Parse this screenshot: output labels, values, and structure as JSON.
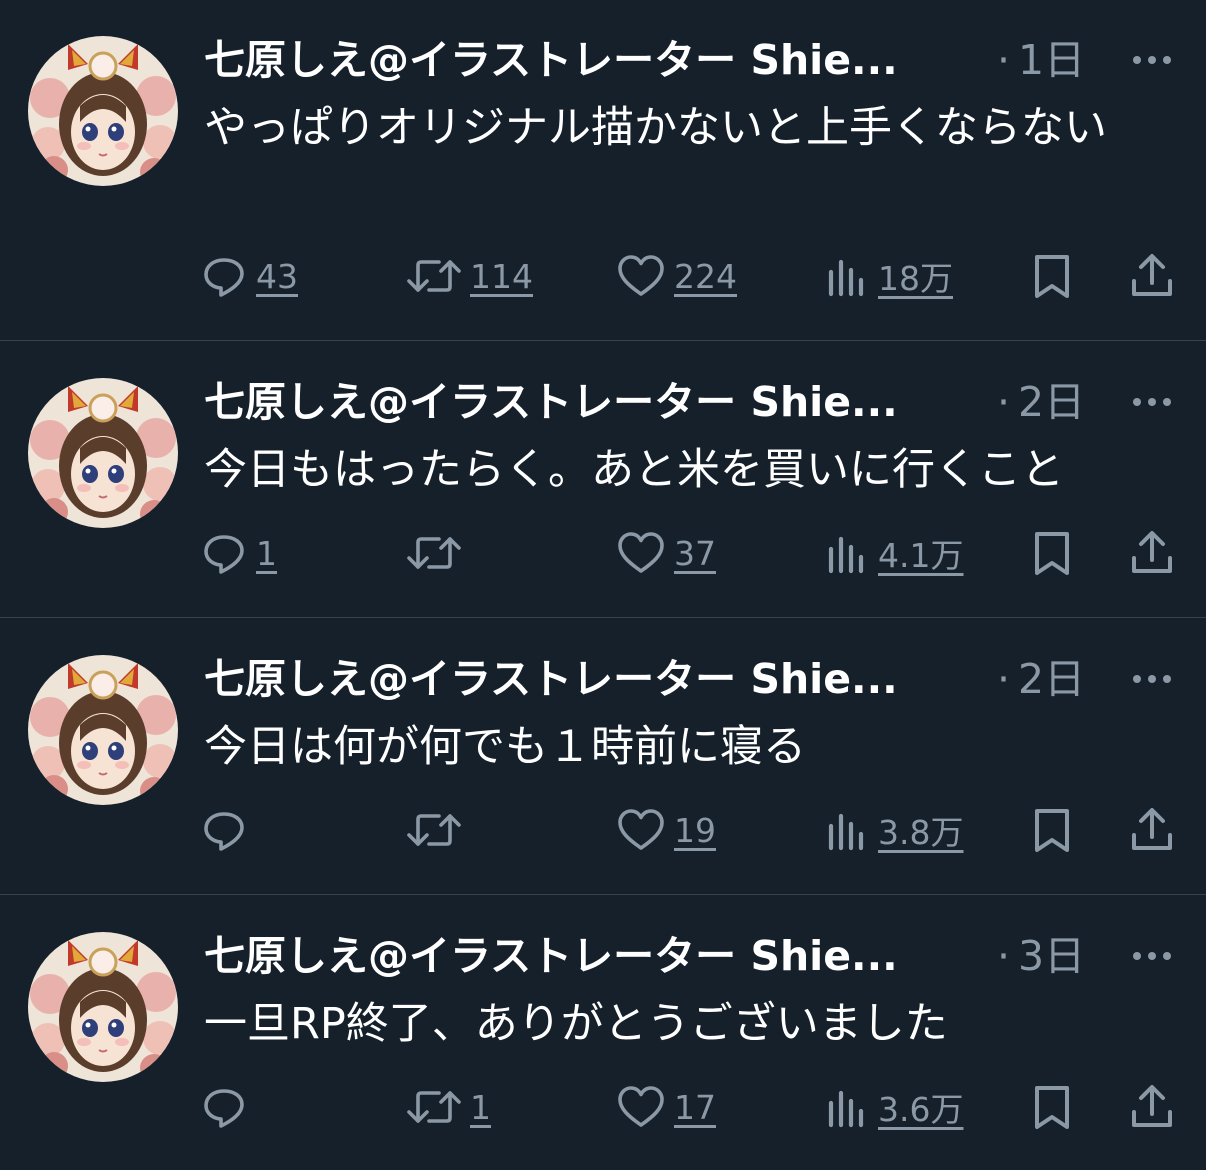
{
  "colors": {
    "background": "#15202b",
    "text_primary": "#ffffff",
    "text_secondary": "#8b98a5",
    "divider": "#38444d"
  },
  "icons": {
    "reply": "speech-bubble-icon",
    "retweet": "retweet-arrows-icon",
    "like": "heart-icon",
    "views": "bar-chart-icon",
    "bookmark": "bookmark-icon",
    "share": "share-upload-icon",
    "more": "more-dots-icon"
  },
  "separator": "·",
  "tweets": [
    {
      "display_name": "七原しえ@イラストレーター Shie...",
      "time": "1日",
      "text": "やっぱりオリジナル描かないと上手くならない",
      "replies": "43",
      "retweets": "114",
      "likes": "224",
      "views": "18万"
    },
    {
      "display_name": "七原しえ@イラストレーター Shie...",
      "time": "2日",
      "text": "今日もはったらく。あと米を買いに行くこと",
      "replies": "1",
      "retweets": "",
      "likes": "37",
      "views": "4.1万"
    },
    {
      "display_name": "七原しえ@イラストレーター Shie...",
      "time": "2日",
      "text": "今日は何が何でも１時前に寝る",
      "replies": "",
      "retweets": "",
      "likes": "19",
      "views": "3.8万"
    },
    {
      "display_name": "七原しえ@イラストレーター Shie...",
      "time": "3日",
      "text": "一旦RP終了、ありがとうございました",
      "replies": "",
      "retweets": "1",
      "likes": "17",
      "views": "3.6万"
    }
  ]
}
